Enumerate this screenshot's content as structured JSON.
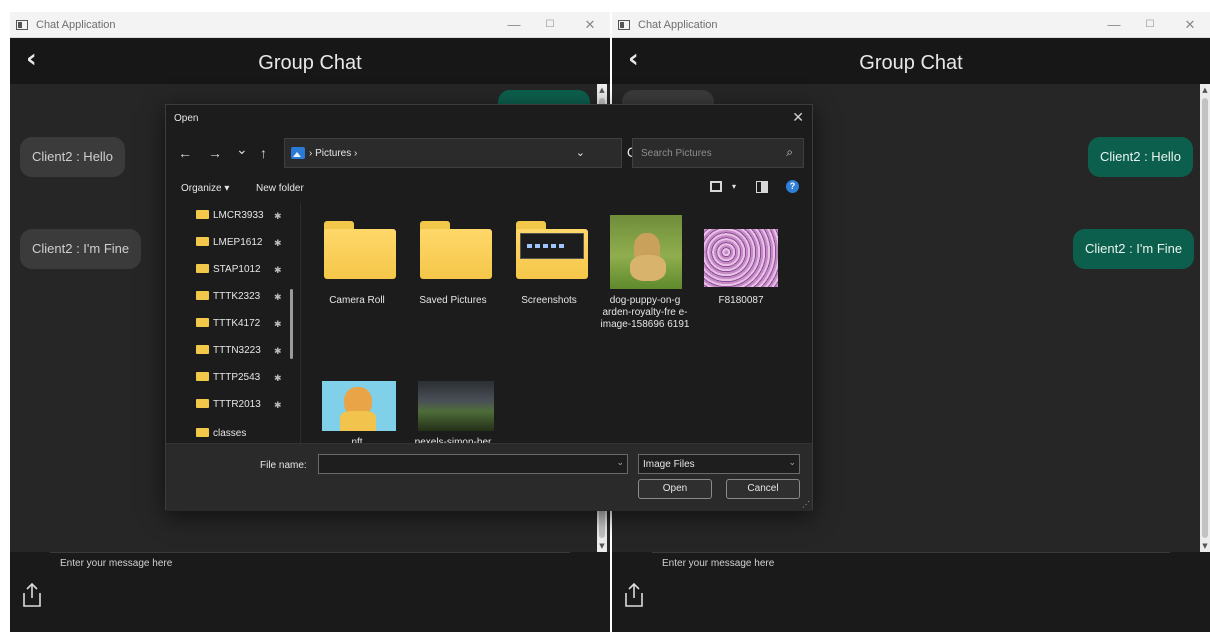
{
  "windows": [
    {
      "title": "Chat Application",
      "header_title": "Group Chat",
      "messages": [
        "Client2 : Hello",
        "Client2 : I'm Fine"
      ],
      "input_placeholder": "Enter your message here"
    },
    {
      "title": "Chat Application",
      "header_title": "Group Chat",
      "messages": [
        "Client2 : Hello",
        "Client2 : I'm Fine"
      ],
      "input_placeholder": "Enter your message here"
    }
  ],
  "window_controls": {
    "minimize": "—",
    "maximize": "☐",
    "close": "✕"
  },
  "dialog": {
    "title": "Open",
    "close": "✕",
    "nav": {
      "back": "←",
      "forward": "→",
      "recent": "⌄",
      "up": "↑"
    },
    "address": {
      "path": "› Pictures ›",
      "dropdown": "⌄",
      "refresh": "C"
    },
    "search_placeholder": "Search Pictures",
    "search_icon": "⌕",
    "toolbar": {
      "organize": "Organize ▾",
      "new_folder": "New folder",
      "view_drop": "▾",
      "help": "?"
    },
    "nav_items": [
      "LMCR3933",
      "LMEP1612",
      "STAP1012",
      "TTTK2323",
      "TTTK4172",
      "TTTN3223",
      "TTTP2543",
      "TTTR2013",
      "classes"
    ],
    "pin_icon": "✱",
    "items": [
      {
        "label": "Camera Roll",
        "kind": "folder"
      },
      {
        "label": "Saved Pictures",
        "kind": "folder"
      },
      {
        "label": "Screenshots",
        "kind": "folder-preview"
      },
      {
        "label": "dog-puppy-on-g arden-royalty-fre e-image-158696 6191",
        "kind": "image-dog"
      },
      {
        "label": "F8180087",
        "kind": "image-pattern"
      },
      {
        "label": "nft",
        "kind": "image-ape"
      },
      {
        "label": "pexels-simon-ber",
        "kind": "image-landscape"
      }
    ],
    "file_name_label": "File name:",
    "file_name_value": "",
    "file_type": "Image Files",
    "dropdown_arrow": "⌄",
    "open_button": "Open",
    "cancel_button": "Cancel"
  },
  "colors": {
    "app_bg": "#262626",
    "header_bg": "#171717",
    "bubble_gray": "#3b3b3b",
    "bubble_green": "#0d5f4d",
    "folder_yellow": "#f5c649"
  }
}
